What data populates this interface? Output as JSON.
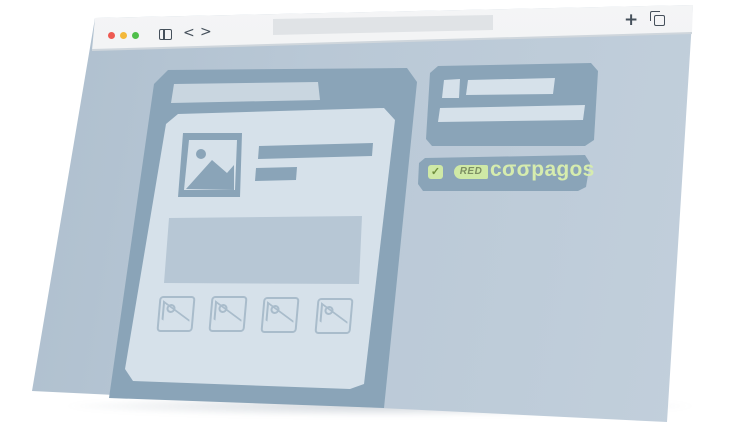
{
  "browser": {
    "window_controls": [
      "close",
      "minimize",
      "zoom"
    ],
    "icons": {
      "sidebar": "sidebar-icon",
      "back": "chevron-left-icon",
      "forward": "chevron-right-icon",
      "new_tab": "plus-icon",
      "tabs": "tabs-icon"
    },
    "address": "",
    "glyphs": {
      "back": "<",
      "forward": ">",
      "new_tab": "+"
    }
  },
  "payment_badge": {
    "checked": true,
    "check_glyph": "✓",
    "network_tag": "RED",
    "brand_name": "cσσpagos"
  },
  "colors": {
    "panel": "#8aa4b8",
    "card": "#d6e1ea",
    "accent_green": "#cfe9a6",
    "window": "#b9c8d6"
  }
}
